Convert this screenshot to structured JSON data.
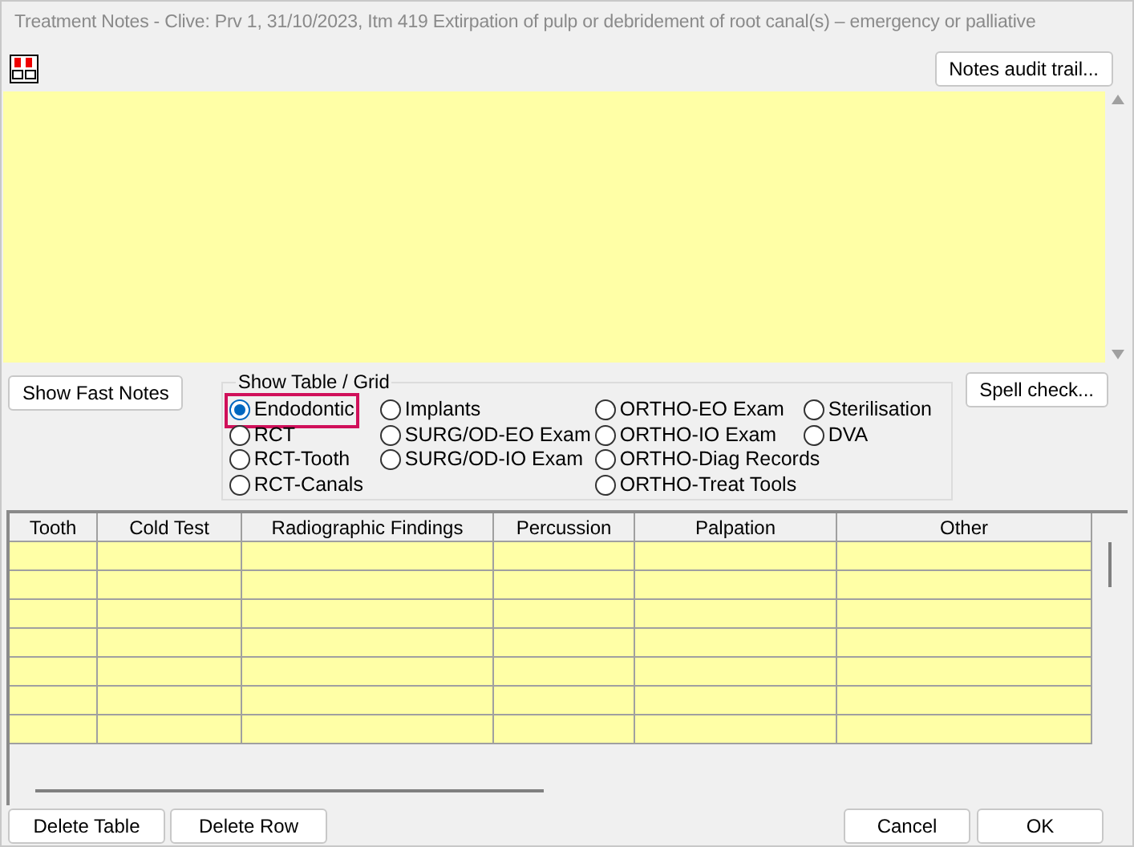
{
  "window": {
    "title": "Treatment Notes - Clive: Prv 1, 31/10/2023, Itm 419 Extirpation of pulp or debridement of root canal(s) – emergency or palliative"
  },
  "toolbar": {
    "audit_button": "Notes audit trail..."
  },
  "fast_notes_button": "Show Fast Notes",
  "spell_check_button": "Spell check...",
  "table_group": {
    "label": "Show Table / Grid",
    "columns": [
      [
        {
          "label": "Endodontic",
          "selected": true
        },
        {
          "label": "RCT",
          "selected": false
        },
        {
          "label": "RCT-Tooth",
          "selected": false
        },
        {
          "label": "RCT-Canals",
          "selected": false
        }
      ],
      [
        {
          "label": "Implants",
          "selected": false
        },
        {
          "label": "SURG/OD-EO Exam",
          "selected": false
        },
        {
          "label": "SURG/OD-IO Exam",
          "selected": false
        }
      ],
      [
        {
          "label": "ORTHO-EO Exam",
          "selected": false
        },
        {
          "label": "ORTHO-IO Exam",
          "selected": false
        },
        {
          "label": "ORTHO-Diag Records",
          "selected": false
        },
        {
          "label": "ORTHO-Treat Tools",
          "selected": false
        }
      ],
      [
        {
          "label": "Sterilisation",
          "selected": false
        },
        {
          "label": "DVA",
          "selected": false
        }
      ]
    ]
  },
  "grid": {
    "columns": [
      "Tooth",
      "Cold Test",
      "Radiographic Findings",
      "Percussion",
      "Palpation",
      "Other"
    ]
  },
  "buttons": {
    "left": [
      "Delete Table",
      "Delete Row"
    ],
    "right": [
      "Cancel",
      "OK"
    ]
  }
}
